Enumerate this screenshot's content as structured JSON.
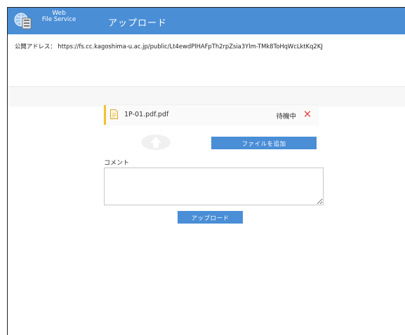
{
  "header": {
    "logo_line1": "Web",
    "logo_line2": "File Service",
    "page_title": "アップロード",
    "logo_icon": "server-globe-icon"
  },
  "public_address": {
    "label": "公開アドレス：",
    "url": "https://fs.cc.kagoshima-u.ac.jp/public/Lt4ewdPlHAFpTh2rpZsia3Ylm-TMk8ToHqWcLktKq2KJ"
  },
  "files": [
    {
      "name": "1P-01.pdf.pdf",
      "status": "待機中",
      "icon": "file-icon",
      "remove_icon": "close-icon"
    }
  ],
  "actions": {
    "add_file_label": "ファイルを追加",
    "upload_label": "アップロード",
    "upload_arrow_icon": "upload-arrow-icon"
  },
  "comment": {
    "label": "コメント",
    "value": ""
  },
  "colors": {
    "accent": "#4a8ed6",
    "pending_bar": "#f2c22f",
    "remove": "#e35050"
  }
}
